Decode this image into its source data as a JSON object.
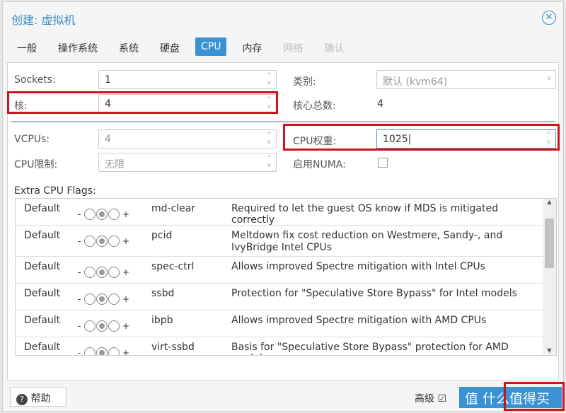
{
  "dialog": {
    "title": "创建: 虚拟机"
  },
  "tabs": [
    "一般",
    "操作系统",
    "系统",
    "硬盘",
    "CPU",
    "内存",
    "网络",
    "确认"
  ],
  "form": {
    "sockets": {
      "label": "Sockets:",
      "value": "1"
    },
    "cores": {
      "label": "核:",
      "value": "4"
    },
    "type": {
      "label": "类别:",
      "value": "默认 (kvm64)"
    },
    "total_cores": {
      "label": "核心总数:",
      "value": "4"
    },
    "vcpus": {
      "label": "VCPUs:",
      "value": "4"
    },
    "cpu_limit": {
      "label": "CPU限制:",
      "value": "无限"
    },
    "cpu_units": {
      "label": "CPU权重:",
      "value": "1025"
    },
    "numa": {
      "label": "启用NUMA:",
      "checked": false
    }
  },
  "flags": {
    "label": "Extra CPU Flags:",
    "rows": [
      {
        "state": "Default",
        "name": "md-clear",
        "desc": "Required to let the guest OS know if MDS is mitigated correctly"
      },
      {
        "state": "Default",
        "name": "pcid",
        "desc": "Meltdown fix cost reduction on Westmere, Sandy-, and IvyBridge Intel CPUs"
      },
      {
        "state": "Default",
        "name": "spec-ctrl",
        "desc": "Allows improved Spectre mitigation with Intel CPUs"
      },
      {
        "state": "Default",
        "name": "ssbd",
        "desc": "Protection for \"Speculative Store Bypass\" for Intel models"
      },
      {
        "state": "Default",
        "name": "ibpb",
        "desc": "Allows improved Spectre mitigation with AMD CPUs"
      },
      {
        "state": "Default",
        "name": "virt-ssbd",
        "desc": "Basis for \"Speculative Store Bypass\" protection for AMD models"
      }
    ]
  },
  "footer": {
    "help": "帮助",
    "advanced": "高级",
    "watermark": "值 什么值得买"
  }
}
